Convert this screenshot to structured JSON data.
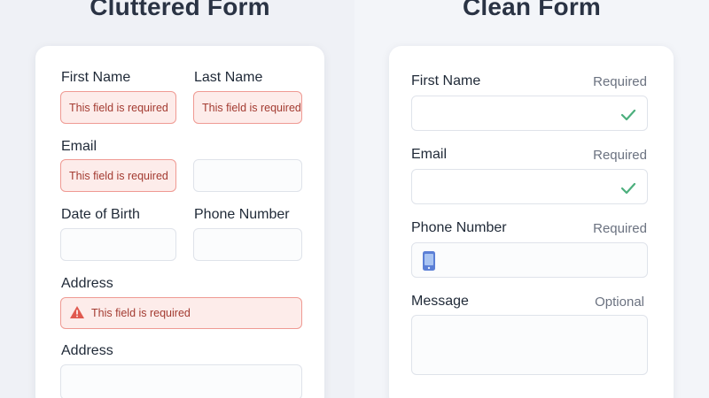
{
  "cluttered": {
    "title": "Cluttered Form",
    "fields": {
      "first_name": "First Name",
      "last_name": "Last Name",
      "email": "Email",
      "dob": "Date of Birth",
      "phone": "Phone Number",
      "address": "Address",
      "address2": "Address"
    },
    "error_message": "This field is required"
  },
  "clean": {
    "title": "Clean Form",
    "fields": {
      "first_name": "First Name",
      "email": "Email",
      "phone": "Phone Number",
      "message": "Message"
    },
    "required_label": "Required",
    "optional_label": "Optional"
  },
  "colors": {
    "error_border": "#ef9a93",
    "error_bg": "#fdecea",
    "success_check": "#4caf7d",
    "heading": "#2a3344"
  },
  "icons": {
    "check": "checkmark-icon",
    "phone": "phone-icon",
    "warning": "warning-icon"
  }
}
